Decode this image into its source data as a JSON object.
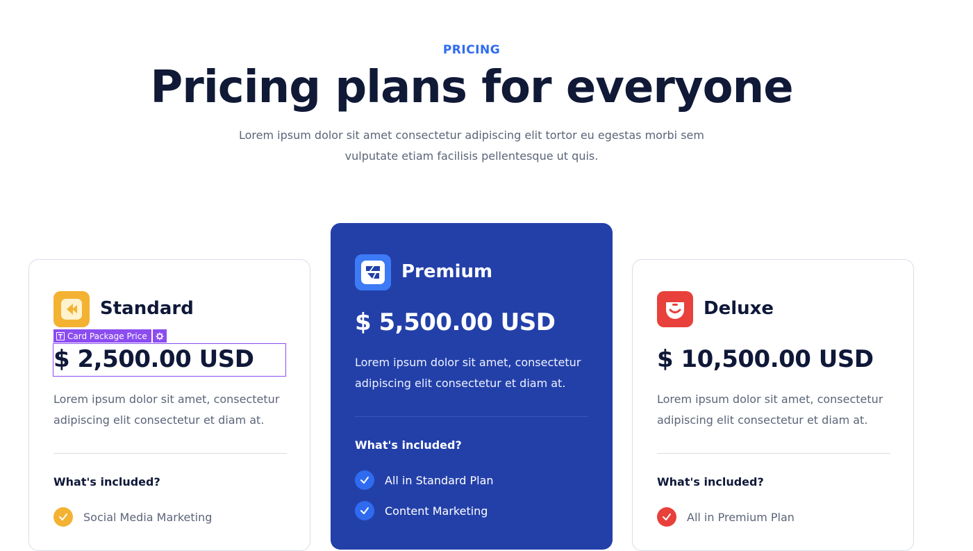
{
  "header": {
    "eyebrow": "PRICING",
    "title": "Pricing plans for everyone",
    "description_line1": "Lorem ipsum dolor sit amet consectetur adipiscing elit tortor eu egestas morbi sem",
    "description_line2": "vulputate etiam facilisis pellentesque ut quis."
  },
  "editor": {
    "element_label": "Card Package Price"
  },
  "plans": [
    {
      "name": "Standard",
      "price": "$ 2,500.00 USD",
      "description_line1": "Lorem ipsum dolor sit amet, consectetur",
      "description_line2": "adipiscing elit consectetur et diam at.",
      "included_label": "What's included?",
      "features": [
        "Social Media Marketing"
      ],
      "accent": "#f3b232"
    },
    {
      "name": "Premium",
      "price": "$ 5,500.00 USD",
      "description_line1": "Lorem ipsum dolor sit amet, consectetur",
      "description_line2": "adipiscing elit consectetur et diam at.",
      "included_label": "What's included?",
      "features": [
        "All in Standard Plan",
        "Content Marketing"
      ],
      "accent": "#2f6bf0"
    },
    {
      "name": "Deluxe",
      "price": "$ 10,500.00 USD",
      "description_line1": "Lorem ipsum dolor sit amet, consectetur",
      "description_line2": "adipiscing elit consectetur et diam at.",
      "included_label": "What's included?",
      "features": [
        "All in Premium Plan"
      ],
      "accent": "#e8403a"
    }
  ],
  "colors": {
    "brand_blue": "#2f6bf0",
    "premium_card": "#2340a9",
    "heading": "#101936",
    "body_text": "#5b6478",
    "editor_purple": "#8b4cf0"
  }
}
